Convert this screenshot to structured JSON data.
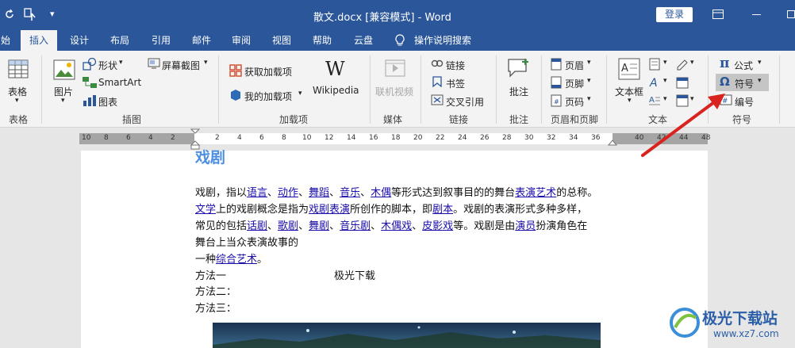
{
  "titlebar": {
    "title": "散文.docx [兼容模式] - Word",
    "login_label": "登录",
    "partial_tab": "始"
  },
  "tabs": [
    "插入",
    "设计",
    "布局",
    "引用",
    "邮件",
    "审阅",
    "视图",
    "帮助",
    "云盘"
  ],
  "tell_me": "操作说明搜索",
  "ribbon": {
    "table": {
      "label": "表格",
      "group": "表格"
    },
    "illustrations": {
      "picture": "图片",
      "shapes": "形状",
      "screenshot": "屏幕截图",
      "smartart": "SmartArt",
      "chart": "图表",
      "group": "插图"
    },
    "addins": {
      "get": "获取加载项",
      "mine": "我的加载项",
      "wikipedia": "Wikipedia",
      "group": "加载项"
    },
    "media": {
      "online_video": "联机视频",
      "group": "媒体"
    },
    "links": {
      "link": "链接",
      "bookmark": "书签",
      "crossref": "交叉引用",
      "group": "链接"
    },
    "comments": {
      "comment": "批注",
      "group": "批注"
    },
    "header_footer": {
      "header": "页眉",
      "footer": "页脚",
      "page_number": "页码",
      "group": "页眉和页脚"
    },
    "text": {
      "textbox": "文本框",
      "group": "文本"
    },
    "symbols": {
      "equation": "公式",
      "symbol": "符号",
      "number": "编号",
      "group": "符号"
    }
  },
  "ruler": [
    "10",
    "8",
    "6",
    "4",
    "2",
    "2",
    "4",
    "6",
    "8",
    "10",
    "12",
    "14",
    "16",
    "18",
    "20",
    "22",
    "24",
    "26",
    "28",
    "30",
    "32",
    "34",
    "36",
    "40",
    "42",
    "44",
    "46",
    "48"
  ],
  "document": {
    "heading": "戏剧",
    "line1": {
      "a": "戏剧，指以",
      "b": "语言",
      "c": "、",
      "d": "动作",
      "e": "、",
      "f": "舞蹈",
      "g": "、",
      "h": "音乐",
      "i": "、",
      "j": "木偶",
      "k": "等形式达到叙事目的的舞台",
      "l": "表演艺术",
      "m": "的总称。"
    },
    "line2": {
      "a": "文学",
      "b": "上的戏剧概念是指为",
      "c": "戏剧表演",
      "d": "所创作的脚本，即",
      "e": "剧本",
      "f": "。戏剧的表演形式多种多样，"
    },
    "line3": {
      "a": "常见的包括",
      "b": "话剧",
      "c": "、",
      "d": "歌剧",
      "e": "、",
      "f": "舞剧",
      "g": "、",
      "h": "音乐剧",
      "i": "、",
      "j": "木偶戏",
      "k": "、",
      "l": "皮影戏",
      "m": "等。戏剧是由",
      "n": "演员",
      "o": "扮演角色在"
    },
    "line4": "舞台上当众表演故事的",
    "line5": {
      "a": "一种",
      "b": "综合艺术",
      "c": "。"
    },
    "method1": "方法一",
    "method1_note": "极光下载",
    "method2": "方法二：",
    "method3": "方法三："
  },
  "watermark": {
    "name": "极光下载站",
    "url": "www.xz7.com"
  },
  "colors": {
    "brand": "#2b579a",
    "link": "#1a0dab",
    "heading": "#4f8fe0",
    "arrow": "#d9231f"
  }
}
